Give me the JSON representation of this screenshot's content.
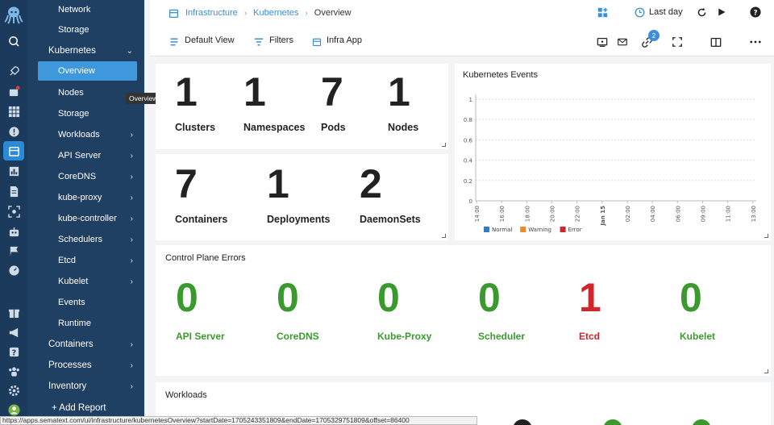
{
  "sidebar": {
    "items": [
      {
        "label": "Network",
        "level": 2
      },
      {
        "label": "Storage",
        "level": 2
      },
      {
        "label": "Kubernetes",
        "level": 1,
        "chevron": "⌄"
      },
      {
        "label": "Overview",
        "level": 2,
        "selected": true
      },
      {
        "label": "Nodes",
        "level": 2
      },
      {
        "label": "Storage",
        "level": 2
      },
      {
        "label": "Workloads",
        "level": 2,
        "chevron": "›"
      },
      {
        "label": "API Server",
        "level": 2,
        "chevron": "›"
      },
      {
        "label": "CoreDNS",
        "level": 2,
        "chevron": "›"
      },
      {
        "label": "kube-proxy",
        "level": 2,
        "chevron": "›"
      },
      {
        "label": "kube-controller",
        "level": 2,
        "chevron": "›"
      },
      {
        "label": "Schedulers",
        "level": 2,
        "chevron": "›"
      },
      {
        "label": "Etcd",
        "level": 2,
        "chevron": "›"
      },
      {
        "label": "Kubelet",
        "level": 2,
        "chevron": "›"
      },
      {
        "label": "Events",
        "level": 2
      },
      {
        "label": "Runtime",
        "level": 2
      },
      {
        "label": "Containers",
        "level": 1,
        "chevron": "›"
      },
      {
        "label": "Processes",
        "level": 1,
        "chevron": "›"
      },
      {
        "label": "Inventory",
        "level": 1,
        "chevron": "›"
      }
    ],
    "add_report": "+ Add Report",
    "tooltip": "Overview"
  },
  "header": {
    "breadcrumb": [
      "Infrastructure",
      "Kubernetes",
      "Overview"
    ],
    "time_range": "Last day"
  },
  "toolbar": {
    "default_view": "Default View",
    "filters": "Filters",
    "infra_app": "Infra App",
    "link_badge": "2"
  },
  "stats_top": [
    {
      "value": "1",
      "label": "Clusters"
    },
    {
      "value": "1",
      "label": "Namespaces"
    },
    {
      "value": "7",
      "label": "Pods"
    },
    {
      "value": "1",
      "label": "Nodes"
    }
  ],
  "stats_bottom": [
    {
      "value": "7",
      "label": "Containers"
    },
    {
      "value": "1",
      "label": "Deployments"
    },
    {
      "value": "2",
      "label": "DaemonSets"
    }
  ],
  "events_panel": {
    "title": "Kubernetes Events"
  },
  "chart_data": {
    "type": "line",
    "title": "Kubernetes Events",
    "x": [
      "14:00",
      "16:00",
      "18:00",
      "20:00",
      "22:00",
      "Jan 15",
      "02:00",
      "04:00",
      "06:00",
      "09:00",
      "11:00",
      "13:00"
    ],
    "yticks": [
      "1",
      "0.8",
      "0.6",
      "0.4",
      "0.2",
      "0"
    ],
    "ylim": [
      0,
      1
    ],
    "series": [
      {
        "name": "Normal",
        "color": "#3b78c3",
        "values": []
      },
      {
        "name": "Warning",
        "color": "#f08a24",
        "values": []
      },
      {
        "name": "Error",
        "color": "#d0262b",
        "values": []
      }
    ],
    "grid": true,
    "legend": "bottom"
  },
  "control_plane": {
    "title": "Control Plane Errors",
    "items": [
      {
        "value": "0",
        "label": "API Server",
        "status": "ok"
      },
      {
        "value": "0",
        "label": "CoreDNS",
        "status": "ok"
      },
      {
        "value": "0",
        "label": "Kube-Proxy",
        "status": "ok"
      },
      {
        "value": "0",
        "label": "Scheduler",
        "status": "ok"
      },
      {
        "value": "1",
        "label": "Etcd",
        "status": "error"
      },
      {
        "value": "0",
        "label": "Kubelet",
        "status": "ok"
      }
    ]
  },
  "workloads": {
    "title": "Workloads"
  },
  "status_url": "https://apps.sematext.com/ui/infrastructure/kubernetesOverview?startDate=1705243351809&endDate=1705329751809&offset=86400"
}
